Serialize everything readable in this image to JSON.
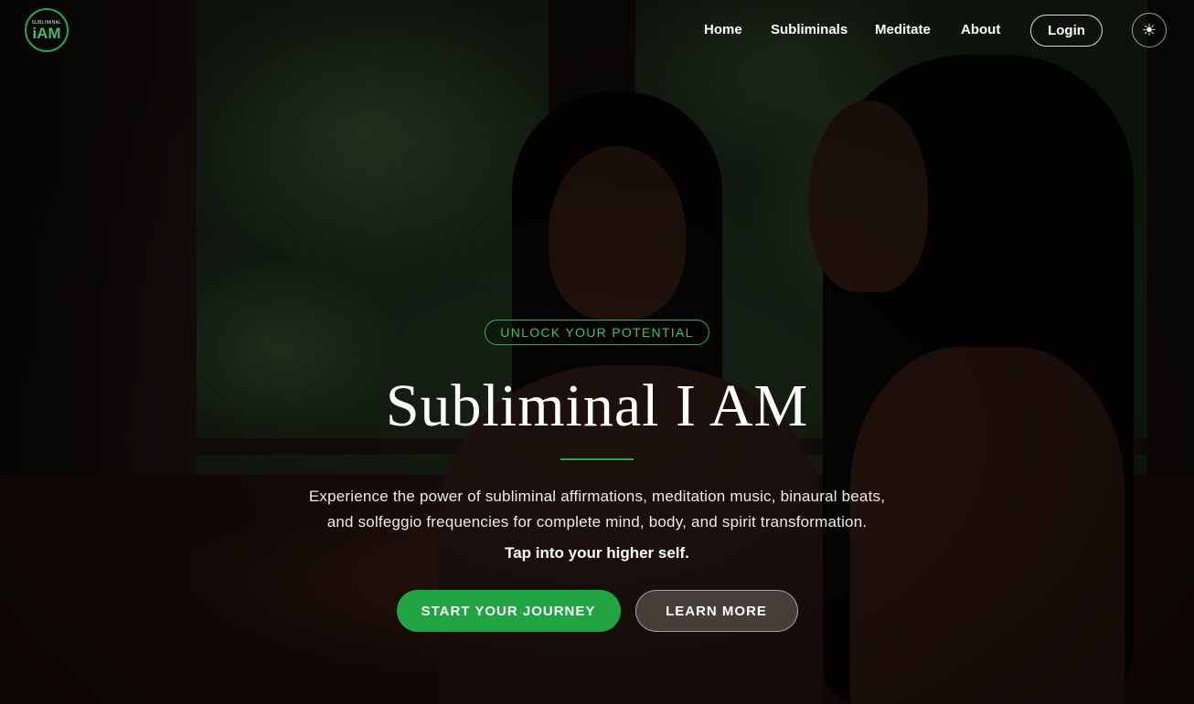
{
  "brand": {
    "logo_small_text": "SUBLIMINAL",
    "logo_big_text": "iAM",
    "logo_icon": "brand-logo",
    "accent_color": "#21a542"
  },
  "nav": {
    "links": [
      {
        "label": "Home"
      },
      {
        "label": "Subliminals"
      },
      {
        "label": "Meditate"
      },
      {
        "label": "About"
      }
    ],
    "login_label": "Login",
    "theme_icon": "sun-icon",
    "theme_glyph": "☀"
  },
  "hero": {
    "badge": "UNLOCK YOUR POTENTIAL",
    "title": "Subliminal I AM",
    "description_line1": "Experience the power of subliminal affirmations, meditation music, binaural beats,",
    "description_line2": "and solfeggio frequencies for complete mind, body, and spirit transformation.",
    "tagline": "Tap into your higher self.",
    "primary_button": "START YOUR JOURNEY",
    "secondary_button": "LEARN MORE"
  }
}
